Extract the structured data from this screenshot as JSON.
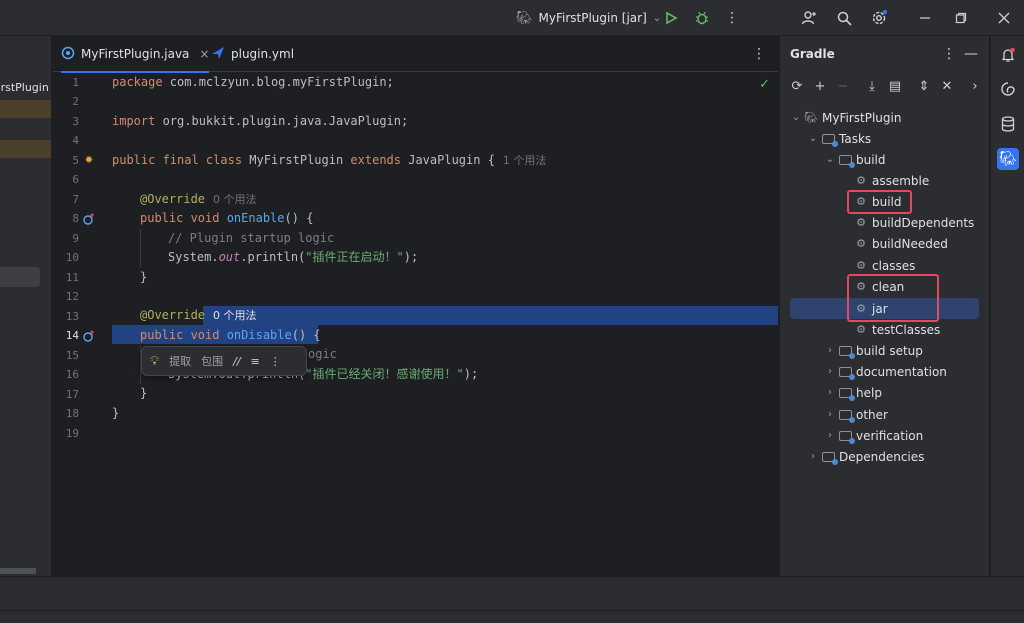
{
  "titlebar": {
    "run_config": "MyFirstPlugin [jar]",
    "icons": [
      "gradle-elephant-icon",
      "chevron-down-icon",
      "run-icon",
      "debug-icon",
      "more-icon",
      "add-user-icon",
      "search-icon",
      "settings-icon",
      "minimize-icon",
      "restore-icon",
      "close-icon"
    ]
  },
  "project_panel": {
    "truncated_text": "FirstPlugin"
  },
  "tabs": [
    {
      "label": "MyFirstPlugin.java",
      "active": true,
      "close": "×"
    },
    {
      "label": "plugin.yml",
      "active": false
    }
  ],
  "editor": {
    "line_numbers": [
      "1",
      "2",
      "3",
      "4",
      "5",
      "6",
      "7",
      "8",
      "9",
      "10",
      "11",
      "12",
      "13",
      "14",
      "15",
      "16",
      "17",
      "18",
      "19"
    ],
    "current_line": "14",
    "lines": {
      "l1_pkg_kw": "package",
      "l1_pkg": " com.mclzyun.blog.myFirstPlugin;",
      "l3_import_kw": "import",
      "l3_import": " org.bukkit.plugin.java.JavaPlugin;",
      "l5_kw1": "public final class",
      "l5_name": " MyFirstPlugin ",
      "l5_kw2": "extends",
      "l5_rest": " JavaPlugin {",
      "l5_hint": "1 个用法",
      "l7_ann": "@Override",
      "l7_hint": "0 个用法",
      "l8_kw": "public void",
      "l8_fn": " onEnable",
      "l8_rest": "() {",
      "l9_cmt": "// Plugin startup logic",
      "l10_a": "System.",
      "l10_field": "out",
      "l10_b": ".println(",
      "l10_str": "\"插件正在启动！\"",
      "l10_c": ");",
      "l11": "}",
      "l14_ann": "@Override",
      "l14_hint": "0 个用法",
      "l14_kw": "public void",
      "l14_fn": " onDisable",
      "l14_rest": "() {",
      "l15_tail": "ogic",
      "l16_a": "System.out.println(",
      "l16_str": "\"插件已经关闭！感谢使用！\"",
      "l16_c": ");",
      "l17": "}",
      "l18": "}"
    },
    "float_toolbar": {
      "extract": "提取",
      "surround": "包围",
      "comment": "//",
      "format": "≡",
      "more": "⋮"
    }
  },
  "gradle": {
    "title": "Gradle",
    "tree": {
      "root": "MyFirstPlugin",
      "tasks": "Tasks",
      "build_group": "build",
      "items": [
        "assemble",
        "build",
        "buildDependents",
        "buildNeeded",
        "classes",
        "clean",
        "jar",
        "testClasses"
      ],
      "groups": [
        "build setup",
        "documentation",
        "help",
        "other",
        "verification"
      ],
      "dependencies": "Dependencies"
    },
    "selected": "jar",
    "accent": "#e5475e"
  },
  "colors": {
    "selection": "#214283",
    "tree_selection": "#2e436e",
    "accent_blue": "#3574f0"
  }
}
